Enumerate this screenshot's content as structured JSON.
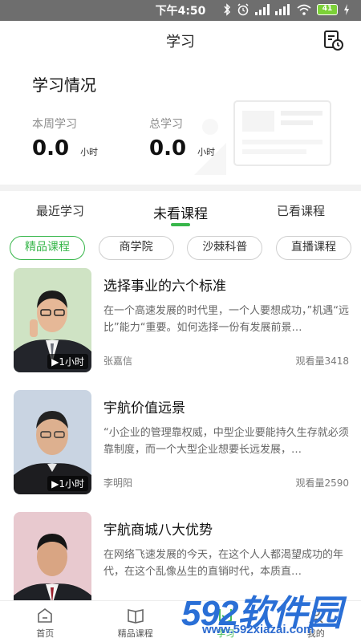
{
  "status_bar": {
    "time": "下午4:50",
    "battery": "41"
  },
  "header": {
    "title": "学习",
    "history_icon": "study-record-icon"
  },
  "study_stats": {
    "title": "学习情况",
    "weekly": {
      "label": "本周学习",
      "value": "0.0",
      "unit": "小时"
    },
    "total": {
      "label": "总学习",
      "value": "0.0",
      "unit": "小时"
    }
  },
  "main_tabs": [
    {
      "label": "最近学习",
      "active": false
    },
    {
      "label": "未看课程",
      "active": true
    },
    {
      "label": "已看课程",
      "active": false
    }
  ],
  "category_chips": [
    {
      "label": "精品课程",
      "active": true
    },
    {
      "label": "商学院",
      "active": false
    },
    {
      "label": "沙棘科普",
      "active": false
    },
    {
      "label": "直播课程",
      "active": false
    }
  ],
  "courses": [
    {
      "title": "选择事业的六个标准",
      "desc": "在一个高速发展的时代里，一个人要想成功，”机遇“远比”能力“重要。如何选择一份有发展前景…",
      "author": "张嘉信",
      "views": "观看量3418",
      "duration": "1小时"
    },
    {
      "title": "宇航价值远景",
      "desc": "“小企业的管理靠权威，中型企业要能持久生存就必须靠制度，而一个大型企业想要长远发展，…",
      "author": "李明阳",
      "views": "观看量2590",
      "duration": "1小时"
    },
    {
      "title": "宇航商城八大优势",
      "desc": "在网络飞速发展的今天，在这个人人都渴望成功的年代，在这个乱像丛生的直销时代，本质直…",
      "author": "",
      "views": "",
      "duration": ""
    }
  ],
  "bottom_nav": [
    {
      "label": "首页",
      "icon": "home-icon",
      "active": false
    },
    {
      "label": "精品课程",
      "icon": "book-icon",
      "active": false
    },
    {
      "label": "学习",
      "icon": "study-icon",
      "active": true
    },
    {
      "label": "我的",
      "icon": "profile-icon",
      "active": false
    }
  ],
  "watermark": {
    "brand": "592软件园",
    "url": "www.592xiazai.com"
  },
  "colors": {
    "accent": "#37b64a",
    "status_bar": "#6e6e6e",
    "watermark": "#2a6fd6"
  }
}
